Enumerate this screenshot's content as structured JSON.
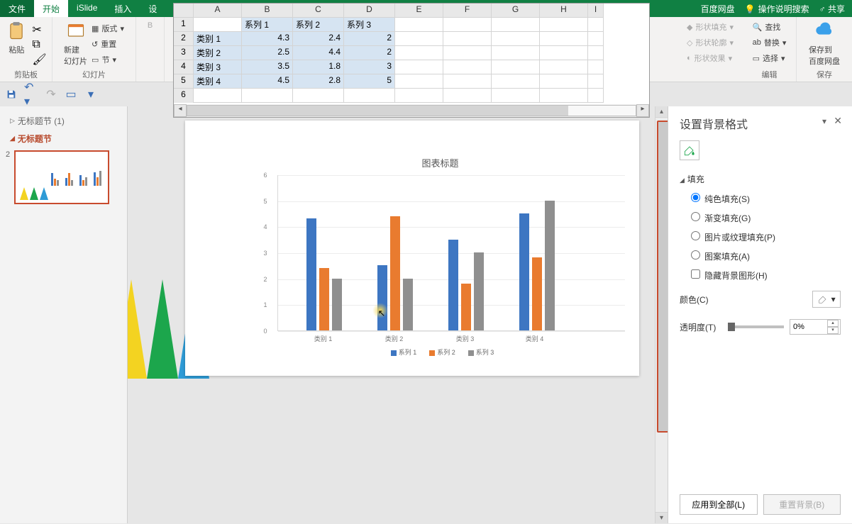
{
  "tabs": {
    "file": "文件",
    "home": "开始",
    "islide": "iSlide",
    "insert": "插入",
    "design": "设",
    "baidu": "百度网盘",
    "tell": "操作说明搜索",
    "share": "共享"
  },
  "ribbon": {
    "clipboard": {
      "paste": "粘贴",
      "caption": "剪贴板"
    },
    "slides": {
      "newslide": "新建\n幻灯片",
      "layout": "版式",
      "reset": "重置",
      "section": "节",
      "caption": "幻灯片"
    },
    "shape": {
      "fill": "形状填充",
      "outline": "形状轮廓",
      "effects": "形状效果"
    },
    "editing": {
      "find": "查找",
      "replace": "替换",
      "select": "选择",
      "caption": "编辑"
    },
    "baidu": {
      "save": "保存到\n百度网盘",
      "caption": "保存"
    }
  },
  "qat": {},
  "outline": {
    "untitled_section_count": "无标题节  (1)",
    "untitled_section": "无标题节",
    "slidenum": "2"
  },
  "excel": {
    "cols": [
      "A",
      "B",
      "C",
      "D",
      "E",
      "F",
      "G",
      "H",
      "I"
    ],
    "rows": [
      "1",
      "2",
      "3",
      "4",
      "5",
      "6"
    ],
    "headers": [
      "",
      "系列 1",
      "系列 2",
      "系列 3"
    ],
    "data": [
      [
        "类别 1",
        "4.3",
        "2.4",
        "2"
      ],
      [
        "类别 2",
        "2.5",
        "4.4",
        "2"
      ],
      [
        "类别 3",
        "3.5",
        "1.8",
        "3"
      ],
      [
        "类别 4",
        "4.5",
        "2.8",
        "5"
      ]
    ]
  },
  "chart_data": {
    "type": "bar",
    "title": "图表标题",
    "categories": [
      "类别 1",
      "类别 2",
      "类别 3",
      "类别 4"
    ],
    "series": [
      {
        "name": "系列 1",
        "values": [
          4.3,
          2.5,
          3.5,
          4.5
        ],
        "color": "#3d76c2"
      },
      {
        "name": "系列 2",
        "values": [
          2.4,
          4.4,
          1.8,
          2.8
        ],
        "color": "#e97b2f"
      },
      {
        "name": "系列 3",
        "values": [
          2,
          2,
          3,
          5
        ],
        "color": "#8f8f8f"
      }
    ],
    "ylim": [
      0,
      6
    ],
    "yticks": [
      0,
      1,
      2,
      3,
      4,
      5,
      6
    ]
  },
  "rpane": {
    "title": "设置背景格式",
    "section_fill": "填充",
    "fill_solid": "纯色填充(S)",
    "fill_gradient": "渐变填充(G)",
    "fill_picture": "图片或纹理填充(P)",
    "fill_pattern": "图案填充(A)",
    "hide_bg": "隐藏背景图形(H)",
    "color_lbl": "颜色(C)",
    "opacity_lbl": "透明度(T)",
    "opacity_val": "0%",
    "apply_all": "应用到全部(L)",
    "reset_bg": "重置背景(B)"
  }
}
